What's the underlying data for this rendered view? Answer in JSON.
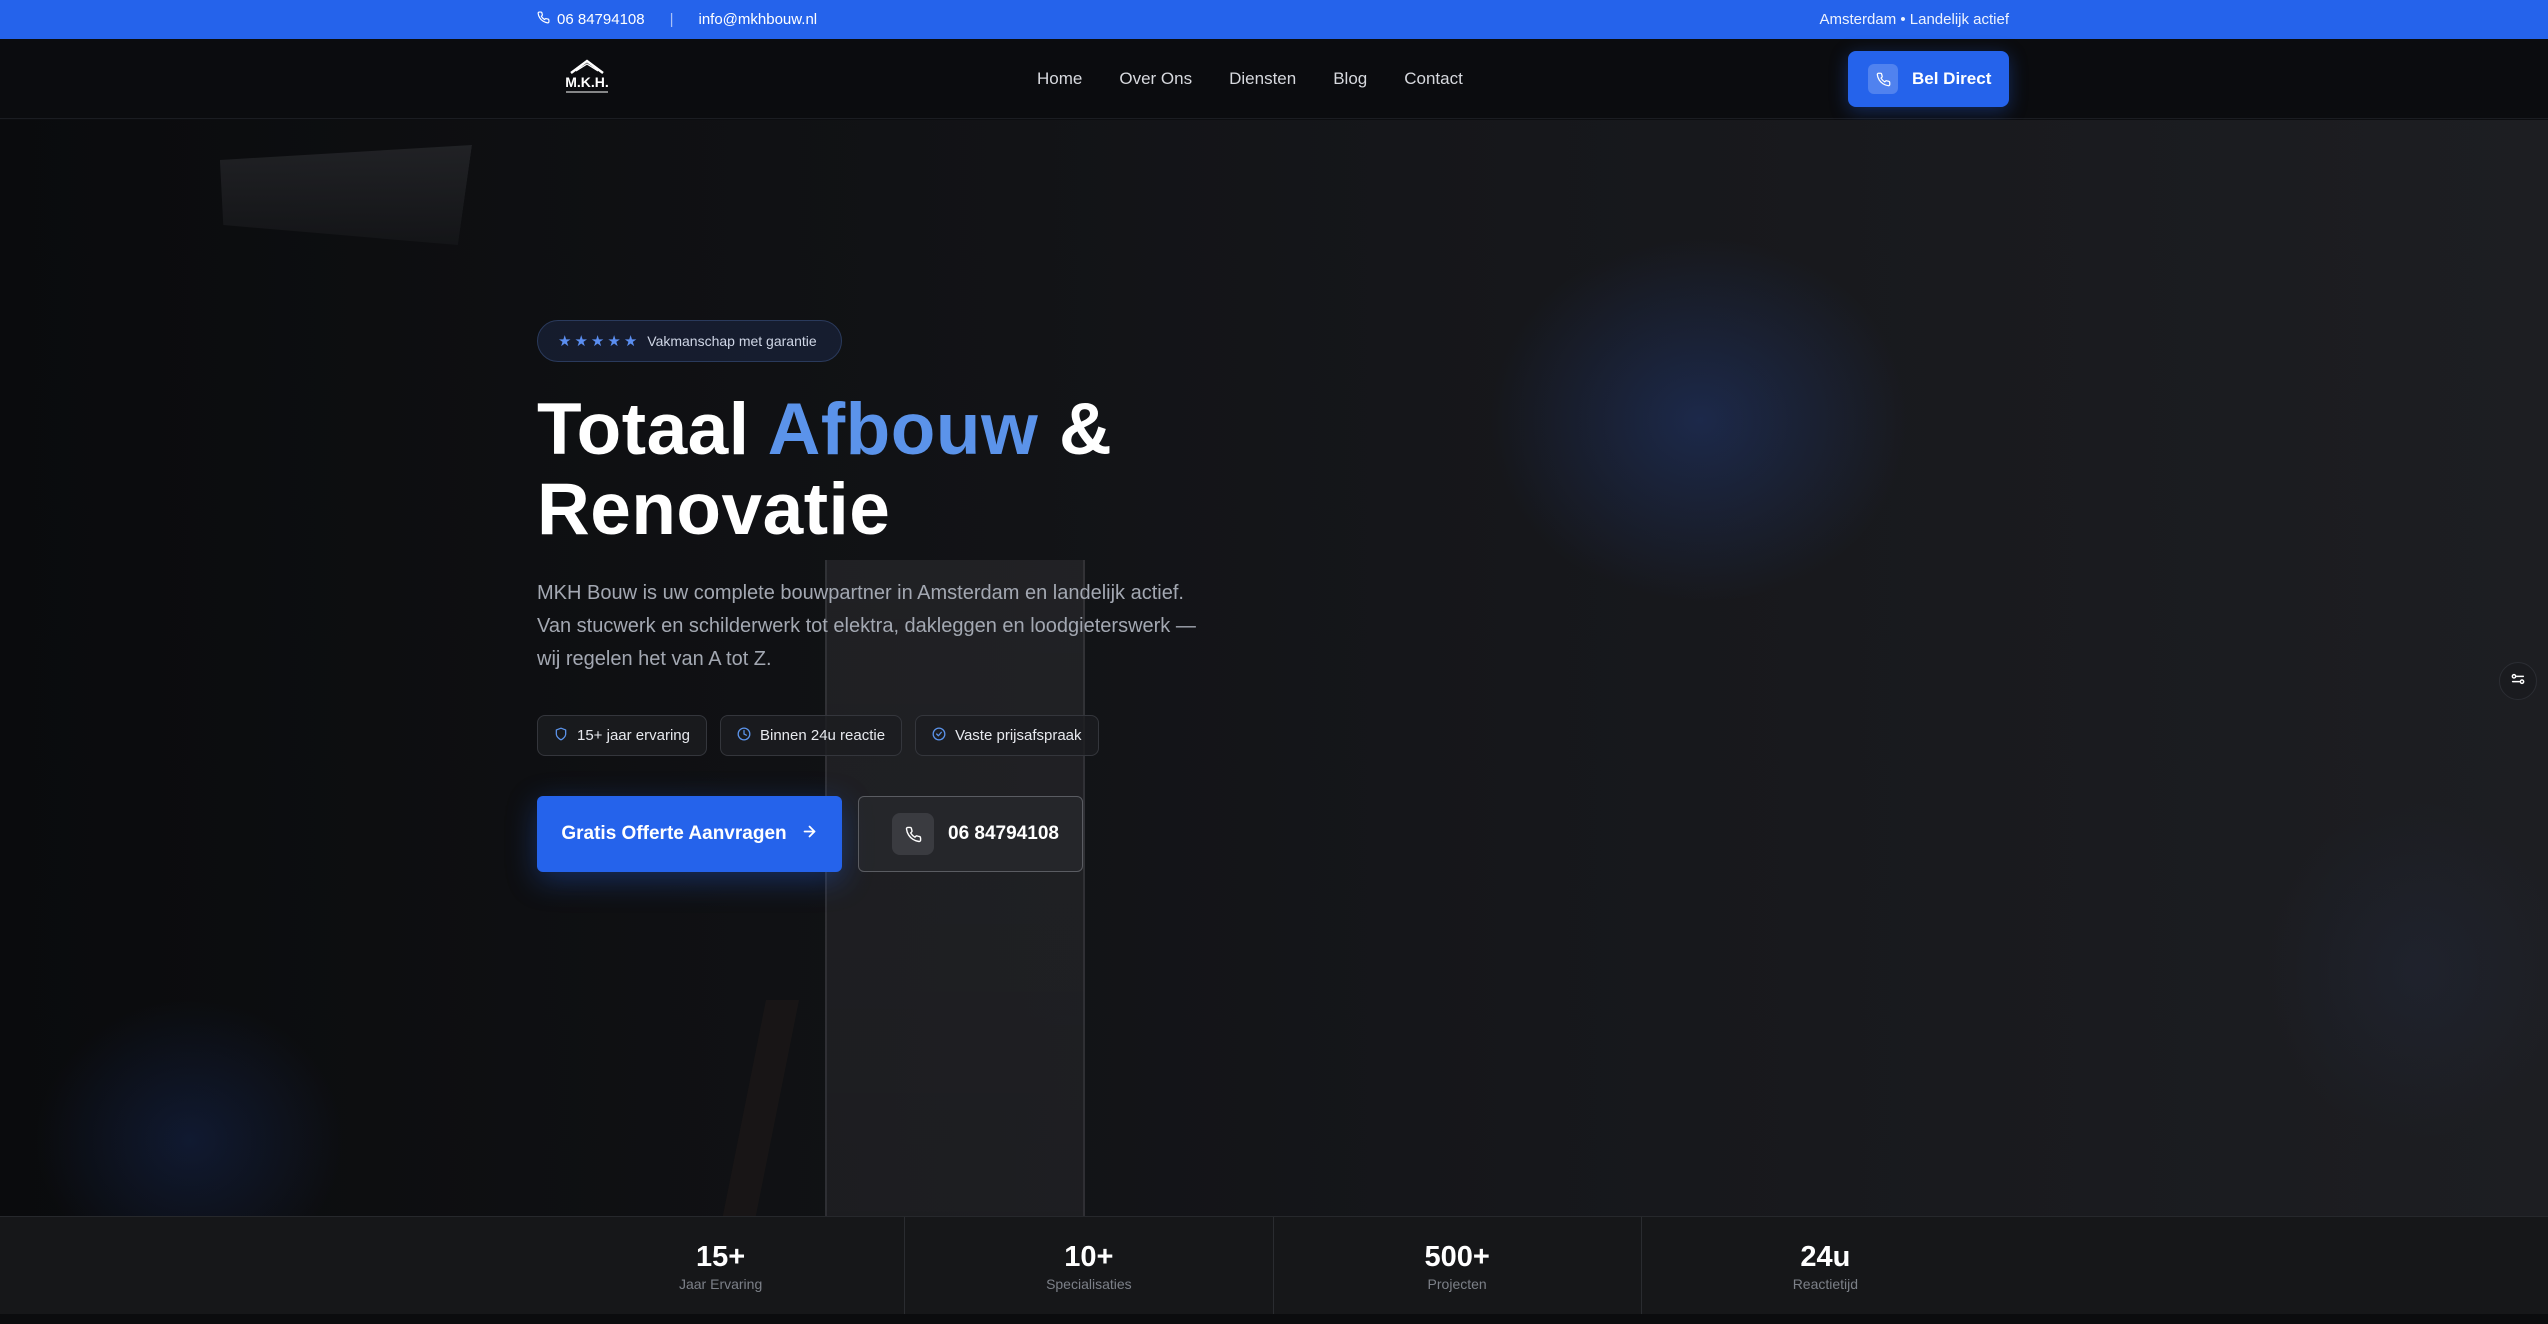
{
  "topbar": {
    "phone": "06 84794108",
    "separator": "|",
    "email": "info@mkhbouw.nl",
    "location": "Amsterdam • Landelijk actief"
  },
  "nav": {
    "logo_text": "M.K.H.",
    "links": [
      "Home",
      "Over Ons",
      "Diensten",
      "Blog",
      "Contact"
    ],
    "cta_label": "Bel Direct"
  },
  "hero": {
    "badge_text": "Vakmanschap met garantie",
    "rating_stars": 5,
    "headline_part1": "Totaal ",
    "headline_accent": "Afbouw",
    "headline_part2": " &",
    "headline_line2": "Renovatie",
    "description": "MKH Bouw is uw complete bouwpartner in Amsterdam en landelijk actief. Van stucwerk en schilderwerk tot elektra, dakleggen en loodgieterswerk — wij regelen het van A tot Z.",
    "chips": [
      {
        "icon": "shield-icon",
        "label": "15+ jaar ervaring"
      },
      {
        "icon": "clock-icon",
        "label": "Binnen 24u reactie"
      },
      {
        "icon": "check-circle-icon",
        "label": "Vaste prijsafspraak"
      }
    ],
    "primary_cta": "Gratis Offerte Aanvragen",
    "secondary_cta": "06 84794108"
  },
  "stats": [
    {
      "value": "15+",
      "label": "Jaar Ervaring"
    },
    {
      "value": "10+",
      "label": "Specialisaties"
    },
    {
      "value": "500+",
      "label": "Projecten"
    },
    {
      "value": "24u",
      "label": "Reactietijd"
    }
  ],
  "colors": {
    "accent": "#2563eb",
    "accent_light": "#5b93ea",
    "background": "#0c0d10"
  }
}
